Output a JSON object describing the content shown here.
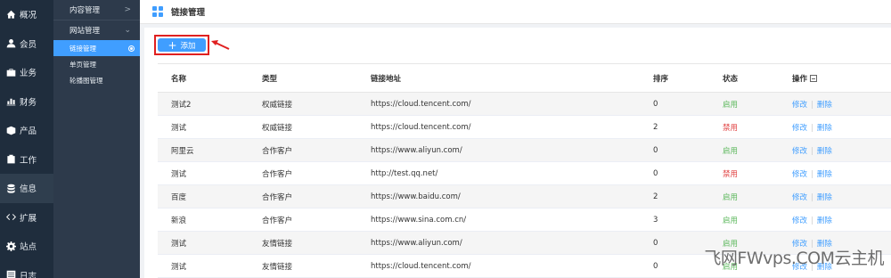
{
  "sidebar": {
    "items": [
      {
        "label": "概况",
        "icon": "home-icon"
      },
      {
        "label": "会员",
        "icon": "user-icon"
      },
      {
        "label": "业务",
        "icon": "briefcase-icon"
      },
      {
        "label": "财务",
        "icon": "chart-icon"
      },
      {
        "label": "产品",
        "icon": "box-icon"
      },
      {
        "label": "工作",
        "icon": "clipboard-icon"
      },
      {
        "label": "信息",
        "icon": "database-icon"
      },
      {
        "label": "扩展",
        "icon": "code-icon"
      },
      {
        "label": "站点",
        "icon": "gear-icon"
      },
      {
        "label": "日志",
        "icon": "list-icon"
      }
    ]
  },
  "subnav": {
    "group1": "内容管理",
    "group2": "网站管理",
    "items": [
      "链接管理",
      "单页管理",
      "轮播图管理"
    ]
  },
  "header": {
    "title": "链接管理"
  },
  "toolbar": {
    "add_label": "添加"
  },
  "table": {
    "headers": {
      "name": "名称",
      "type": "类型",
      "url": "链接地址",
      "order": "排序",
      "status": "状态",
      "ops": "操作"
    },
    "edit_label": "修改",
    "delete_label": "删除",
    "rows": [
      {
        "name": "测试2",
        "type": "权威链接",
        "url": "https://cloud.tencent.com/",
        "order": "0",
        "status": "启用",
        "enabled": true
      },
      {
        "name": "测试",
        "type": "权威链接",
        "url": "https://cloud.tencent.com/",
        "order": "2",
        "status": "禁用",
        "enabled": false
      },
      {
        "name": "阿里云",
        "type": "合作客户",
        "url": "https://www.aliyun.com/",
        "order": "0",
        "status": "启用",
        "enabled": true
      },
      {
        "name": "测试",
        "type": "合作客户",
        "url": "http://test.qq.net/",
        "order": "0",
        "status": "禁用",
        "enabled": false
      },
      {
        "name": "百度",
        "type": "合作客户",
        "url": "https://www.baidu.com/",
        "order": "2",
        "status": "启用",
        "enabled": true
      },
      {
        "name": "新浪",
        "type": "合作客户",
        "url": "https://www.sina.com.cn/",
        "order": "3",
        "status": "启用",
        "enabled": true
      },
      {
        "name": "测试",
        "type": "友情链接",
        "url": "https://www.aliyun.com/",
        "order": "0",
        "status": "启用",
        "enabled": true
      },
      {
        "name": "测试",
        "type": "友情链接",
        "url": "https://cloud.tencent.com/",
        "order": "0",
        "status": "启用",
        "enabled": true
      }
    ]
  },
  "watermark": "飞网FWvps.COM云主机",
  "colors": {
    "accent": "#409eff",
    "sidebar": "#1f2d3d",
    "subnav": "#2d3a4b",
    "enabled": "#5cb85c",
    "disabled": "#e04040"
  }
}
